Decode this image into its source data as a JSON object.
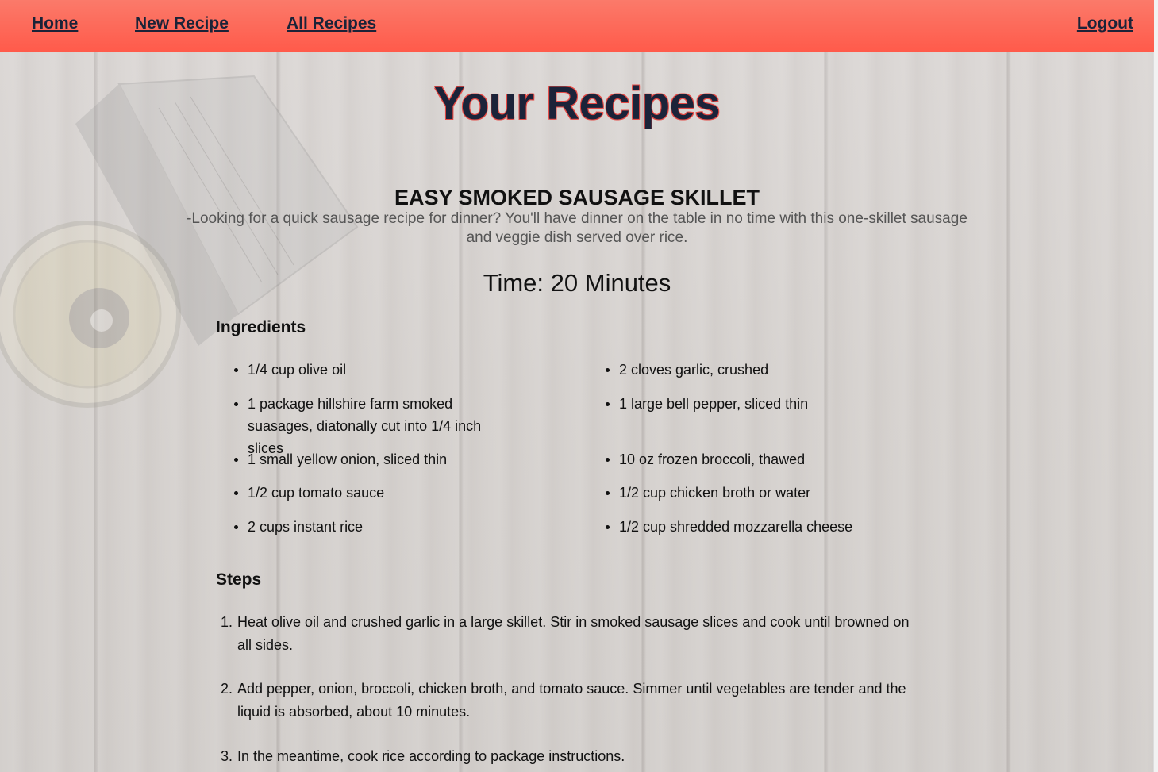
{
  "nav": {
    "home": "Home",
    "new_recipe": "New Recipe",
    "all_recipes": "All Recipes",
    "logout": "Logout"
  },
  "page": {
    "title": "Your Recipes"
  },
  "recipe": {
    "title": "EASY SMOKED SAUSAGE SKILLET",
    "description": "-Looking for a quick sausage recipe for dinner? You'll have dinner on the table in no time with this one-skillet sausage and veggie dish served over rice.",
    "time": "Time: 20 Minutes",
    "ingredients_heading": "Ingredients",
    "ingredients": [
      "1/4 cup olive oil",
      "1 package hillshire farm smoked suasages, diatonally cut into 1/4 inch slices",
      "1 small yellow onion, sliced thin",
      "1/2 cup tomato sauce",
      "2 cups instant rice",
      "2 cloves garlic, crushed",
      "1 large bell pepper, sliced thin",
      "10 oz frozen broccoli, thawed",
      "1/2 cup chicken broth or water",
      "1/2 cup shredded mozzarella cheese"
    ],
    "steps_heading": "Steps",
    "steps": [
      {
        "num": "1.",
        "text": "Heat olive oil and crushed garlic in a large skillet. Stir in smoked sausage slices and cook until browned on all sides."
      },
      {
        "num": "2.",
        "text": "Add pepper, onion, broccoli, chicken broth, and tomato sauce. Simmer until vegetables are tender and the liquid is absorbed, about 10 minutes."
      },
      {
        "num": "3.",
        "text": "In the meantime, cook rice according to package instructions."
      }
    ]
  },
  "colors": {
    "navbar_top": "#fb7a6a",
    "navbar_bottom": "#ff5a4a",
    "nav_text": "#1b2338",
    "title_text": "#1b2339",
    "title_outline": "#e54a45"
  }
}
